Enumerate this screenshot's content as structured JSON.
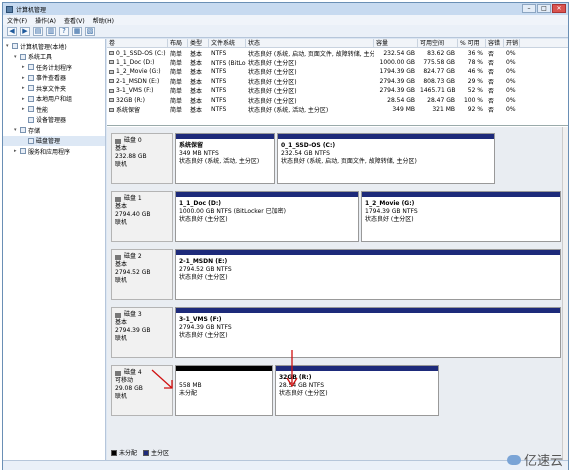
{
  "window": {
    "title": "计算机管理"
  },
  "menu": [
    "文件(F)",
    "操作(A)",
    "查看(V)",
    "帮助(H)"
  ],
  "tree": [
    {
      "label": "计算机管理(本地)",
      "level": 0,
      "exp": "▾"
    },
    {
      "label": "系统工具",
      "level": 1,
      "exp": "▾"
    },
    {
      "label": "任务计划程序",
      "level": 2,
      "exp": "▸"
    },
    {
      "label": "事件查看器",
      "level": 2,
      "exp": "▸"
    },
    {
      "label": "共享文件夹",
      "level": 2,
      "exp": "▸"
    },
    {
      "label": "本地用户和组",
      "level": 2,
      "exp": "▸"
    },
    {
      "label": "性能",
      "level": 2,
      "exp": "▸"
    },
    {
      "label": "设备管理器",
      "level": 2,
      "exp": ""
    },
    {
      "label": "存储",
      "level": 1,
      "exp": "▾"
    },
    {
      "label": "磁盘管理",
      "level": 2,
      "exp": ""
    },
    {
      "label": "服务和应用程序",
      "level": 1,
      "exp": "▸"
    }
  ],
  "volume_table": {
    "headers": [
      "卷",
      "布局",
      "类型",
      "文件系统",
      "状态",
      "容量",
      "可用空间",
      "% 可用",
      "容错",
      "开销"
    ],
    "rows": [
      [
        "0_1_SSD-OS (C:)",
        "简单",
        "基本",
        "NTFS",
        "状态良好 (系统, 启动, 页面文件, 故障转储, 主分区)",
        "232.54 GB",
        "83.62 GB",
        "36 %",
        "否",
        "0%"
      ],
      [
        "1_1_Doc (D:)",
        "简单",
        "基本",
        "NTFS (BitLocker 已加密)",
        "状态良好 (主分区)",
        "1000.00 GB",
        "775.58 GB",
        "78 %",
        "否",
        "0%"
      ],
      [
        "1_2_Movie (G:)",
        "简单",
        "基本",
        "NTFS",
        "状态良好 (主分区)",
        "1794.39 GB",
        "824.77 GB",
        "46 %",
        "否",
        "0%"
      ],
      [
        "2-1_MSDN (E:)",
        "简单",
        "基本",
        "NTFS",
        "状态良好 (主分区)",
        "2794.39 GB",
        "808.73 GB",
        "29 %",
        "否",
        "0%"
      ],
      [
        "3-1_VMS (F:)",
        "简单",
        "基本",
        "NTFS",
        "状态良好 (主分区)",
        "2794.39 GB",
        "1465.71 GB",
        "52 %",
        "否",
        "0%"
      ],
      [
        "32GB (R:)",
        "简单",
        "基本",
        "NTFS",
        "状态良好 (主分区)",
        "28.54 GB",
        "28.47 GB",
        "100 %",
        "否",
        "0%"
      ],
      [
        "系统保留",
        "简单",
        "基本",
        "NTFS",
        "状态良好 (系统, 活动, 主分区)",
        "349 MB",
        "321 MB",
        "92 %",
        "否",
        "0%"
      ]
    ]
  },
  "disks": [
    {
      "name": "磁盘 0",
      "type": "基本",
      "size": "232.88 GB",
      "status": "联机",
      "parts": [
        {
          "name": "系统保留",
          "line2": "349 MB NTFS",
          "line3": "状态良好 (系统, 活动, 主分区)",
          "bar": "blue"
        },
        {
          "name": "0_1_SSD-OS (C:)",
          "line2": "232.54 GB NTFS",
          "line3": "状态良好 (系统, 启动, 页面文件, 故障转储, 主分区)",
          "bar": "blue"
        }
      ]
    },
    {
      "name": "磁盘 1",
      "type": "基本",
      "size": "2794.40 GB",
      "status": "联机",
      "parts": [
        {
          "name": "1_1_Doc (D:)",
          "line2": "1000.00 GB NTFS (BitLocker 已加密)",
          "line3": "状态良好 (主分区)",
          "bar": "blue"
        },
        {
          "name": "1_2_Movie (G:)",
          "line2": "1794.39 GB NTFS",
          "line3": "状态良好 (主分区)",
          "bar": "blue"
        }
      ]
    },
    {
      "name": "磁盘 2",
      "type": "基本",
      "size": "2794.52 GB",
      "status": "联机",
      "parts": [
        {
          "name": "2-1_MSDN (E:)",
          "line2": "2794.52 GB NTFS",
          "line3": "状态良好 (主分区)",
          "bar": "blue"
        }
      ]
    },
    {
      "name": "磁盘 3",
      "type": "基本",
      "size": "2794.39 GB",
      "status": "联机",
      "parts": [
        {
          "name": "3-1_VMS (F:)",
          "line2": "2794.39 GB NTFS",
          "line3": "状态良好 (主分区)",
          "bar": "blue"
        }
      ]
    },
    {
      "name": "磁盘 4",
      "type": "可移动",
      "size": "29.08 GB",
      "status": "联机",
      "parts": [
        {
          "name": "",
          "line2": "558 MB",
          "line3": "未分配",
          "bar": "black"
        },
        {
          "name": "32GB (R:)",
          "line2": "28.54 GB NTFS",
          "line3": "状态良好 (主分区)",
          "bar": "blue"
        }
      ]
    }
  ],
  "legend": [
    {
      "label": "未分配",
      "color": "#000000"
    },
    {
      "label": "主分区",
      "color": "#1d2a7a"
    }
  ],
  "watermark": "亿速云",
  "colors": {
    "primary_partition": "#1d2a7a",
    "unallocated": "#000000",
    "arrow": "#d01010"
  }
}
